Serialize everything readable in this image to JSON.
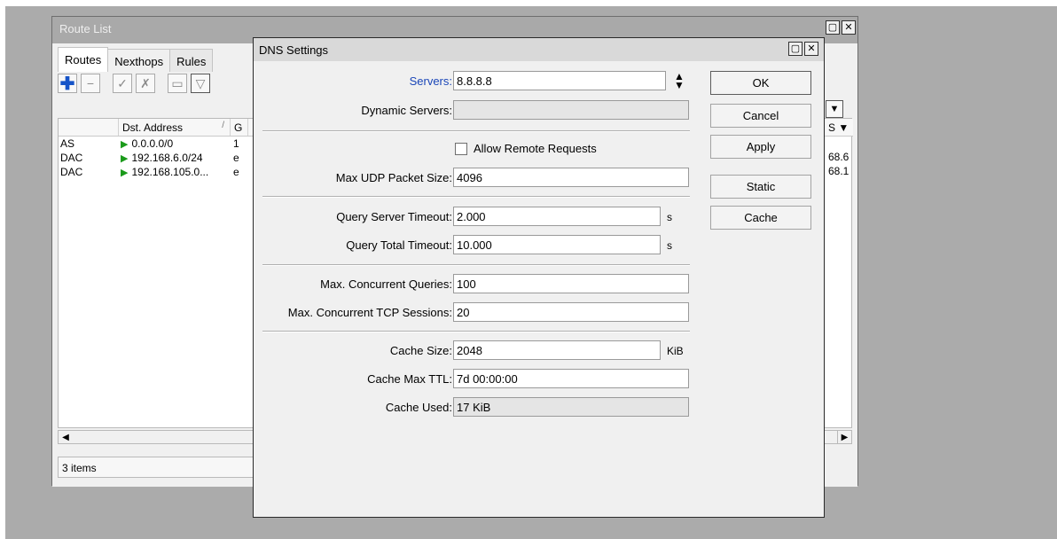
{
  "route_list": {
    "title": "Route List",
    "tabs": [
      {
        "label": "Routes"
      },
      {
        "label": "Nexthops"
      },
      {
        "label": "Rules"
      }
    ],
    "toolbar_icons": [
      "plus-icon",
      "minus-icon",
      "check-icon",
      "cross-icon",
      "comment-icon",
      "filter-icon"
    ],
    "columns": [
      "",
      "Dst. Address",
      "G"
    ],
    "rows": [
      {
        "flags": "AS",
        "dst": "0.0.0.0/0",
        "gw": "1",
        "tail": ""
      },
      {
        "flags": "DAC",
        "dst": "192.168.6.0/24",
        "gw": "e",
        "tail": "68.6"
      },
      {
        "flags": "DAC",
        "dst": "192.168.105.0...",
        "gw": "e",
        "tail": "68.1"
      }
    ],
    "right_header": "S",
    "status": "3 items"
  },
  "dns": {
    "title": "DNS Settings",
    "servers_label": "Servers:",
    "servers_value": "8.8.8.8",
    "dynamic_servers_label": "Dynamic Servers:",
    "dynamic_servers_value": "",
    "allow_remote_label": "Allow Remote Requests",
    "allow_remote_checked": false,
    "max_udp_label": "Max UDP Packet Size:",
    "max_udp_value": "4096",
    "qst_label": "Query Server Timeout:",
    "qst_value": "2.000",
    "qst_unit": "s",
    "qtt_label": "Query Total Timeout:",
    "qtt_value": "10.000",
    "qtt_unit": "s",
    "mcq_label": "Max. Concurrent Queries:",
    "mcq_value": "100",
    "mcts_label": "Max. Concurrent TCP Sessions:",
    "mcts_value": "20",
    "cache_size_label": "Cache Size:",
    "cache_size_value": "2048",
    "cache_size_unit": "KiB",
    "cache_ttl_label": "Cache Max TTL:",
    "cache_ttl_value": "7d 00:00:00",
    "cache_used_label": "Cache Used:",
    "cache_used_value": "17 KiB",
    "buttons": {
      "ok": "OK",
      "cancel": "Cancel",
      "apply": "Apply",
      "static": "Static",
      "cache": "Cache"
    }
  },
  "colors": {
    "desktop": "#ababab",
    "link_label": "#1a46b8",
    "route_flag": "#1a9a1a",
    "add_icon": "#1654c8"
  }
}
